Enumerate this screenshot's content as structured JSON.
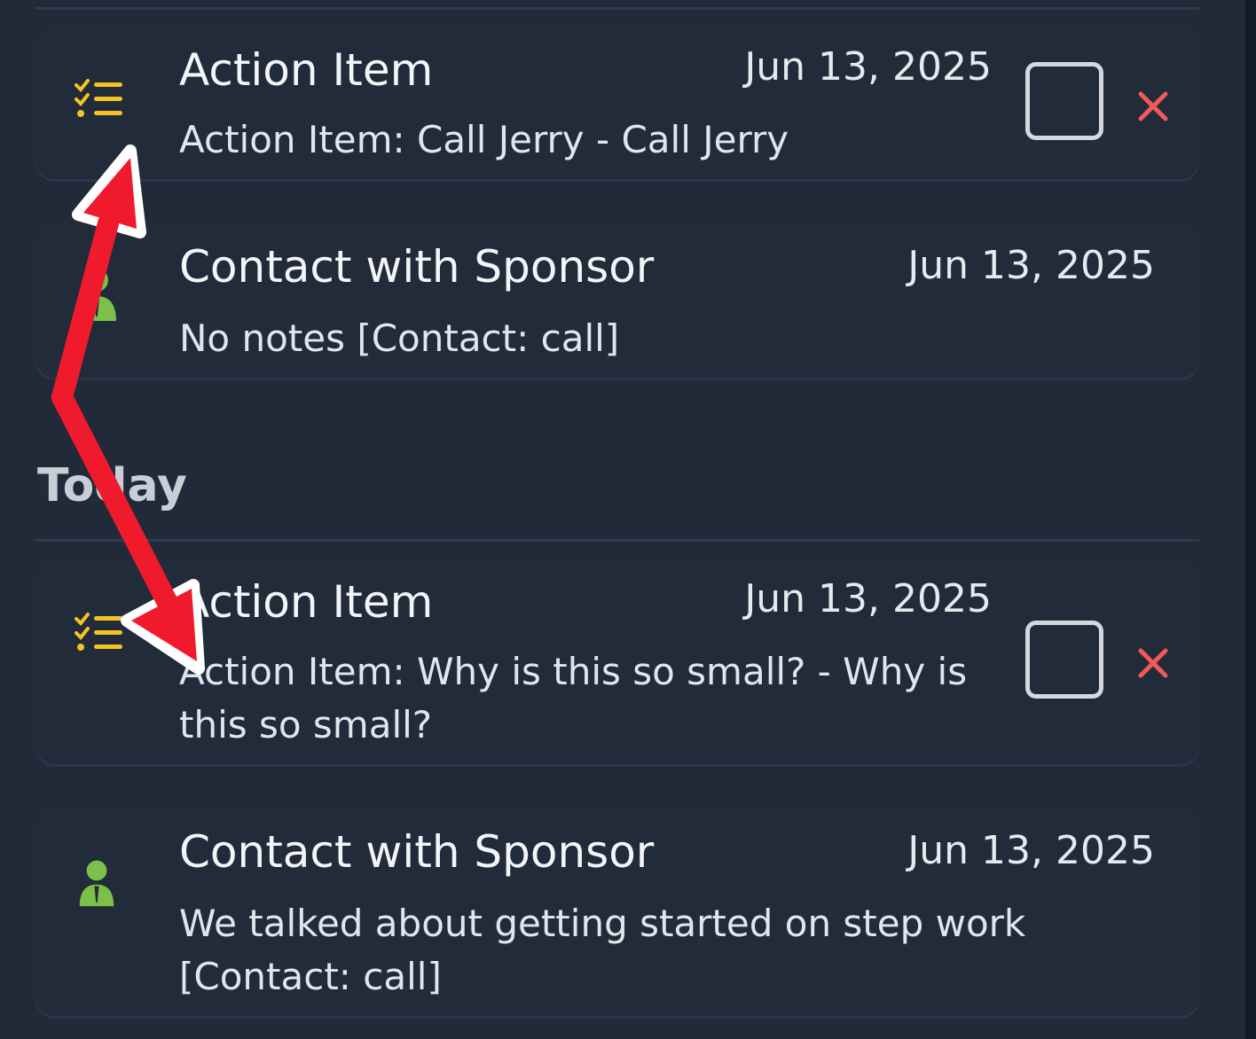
{
  "items": [
    {
      "title": "Action Item",
      "date": "Jun 13, 2025",
      "subtitle": "Action Item: Call Jerry - Call Jerry",
      "icon": "checklist-icon",
      "type": "action"
    },
    {
      "title": "Contact with Sponsor",
      "date": "Jun 13, 2025",
      "subtitle": "No notes [Contact: call]",
      "icon": "person-icon",
      "type": "contact"
    }
  ],
  "section": {
    "title": "Today",
    "items": [
      {
        "title": "Action Item",
        "date": "Jun 13, 2025",
        "subtitle": "Action Item: Why is this so small? - Why is this so small?",
        "icon": "checklist-icon",
        "type": "action"
      },
      {
        "title": "Contact with Sponsor",
        "date": "Jun 13, 2025",
        "subtitle": "We talked about getting started on step work [Contact: call]",
        "icon": "person-icon",
        "type": "contact"
      }
    ]
  },
  "colors": {
    "background": "#212a39",
    "checklist_icon": "#f6c324",
    "person_icon": "#7cc04a",
    "delete": "#f05a5a",
    "annotation_arrow": "#ef1b2c"
  }
}
